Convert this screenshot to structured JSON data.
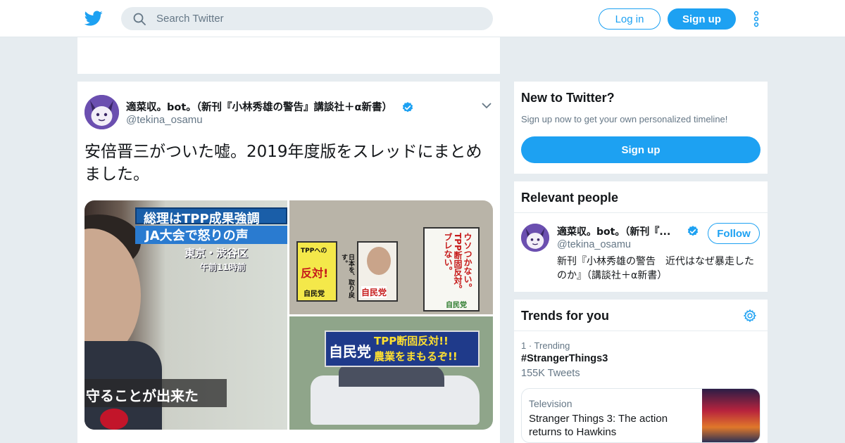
{
  "header": {
    "search_placeholder": "Search Twitter",
    "login_label": "Log in",
    "signup_label": "Sign up"
  },
  "tweet": {
    "author_name": "適菜収。bot。（新刊『小林秀雄の警告』講談社＋α新書）",
    "author_handle": "@tekina_osamu",
    "text": "安倍晋三がついた嘘。2019年度版をスレッドにまとめました。",
    "media": {
      "image1": {
        "caption_line1": "総理はTPP成果強調",
        "caption_line2": "JA大会で怒りの声",
        "location": "東京・渋谷区",
        "time": "午前11時前",
        "subtitle": "守ることが出来た"
      },
      "image2": {
        "poster_left_top": "TPPへの",
        "poster_left_main": "反対!",
        "poster_left_bottom": "自民党",
        "poster_mid": "自民党",
        "poster_mid_side": "日本を、取り戻す。",
        "poster_right_main": "ウソつかない。TPP断固反対。ブレない。",
        "poster_right_bottom": "自民党"
      },
      "image3": {
        "banner_left": "自民党",
        "banner_right_line1": "TPP断固反対!!",
        "banner_right_line2": "農業をまもるぞ!!"
      }
    }
  },
  "sidebar": {
    "new_to_twitter": {
      "title": "New to Twitter?",
      "subtitle": "Sign up now to get your own personalized timeline!",
      "button": "Sign up"
    },
    "relevant_people": {
      "title": "Relevant people",
      "name": "適菜収。bot。（新刊『...",
      "handle": "@tekina_osamu",
      "follow_label": "Follow",
      "bio": "新刊『小林秀雄の警告　近代はなぜ暴走したのか』（講談社＋α新書）"
    },
    "trends": {
      "title": "Trends for you",
      "items": [
        {
          "meta": "1 · Trending",
          "tag": "#StrangerThings3",
          "count": "155K Tweets"
        }
      ],
      "news": {
        "category": "Television",
        "title": "Stranger Things 3: The action returns to Hawkins"
      }
    }
  },
  "colors": {
    "accent": "#1da1f2",
    "background": "#e6ecf0",
    "muted_text": "#657786"
  }
}
